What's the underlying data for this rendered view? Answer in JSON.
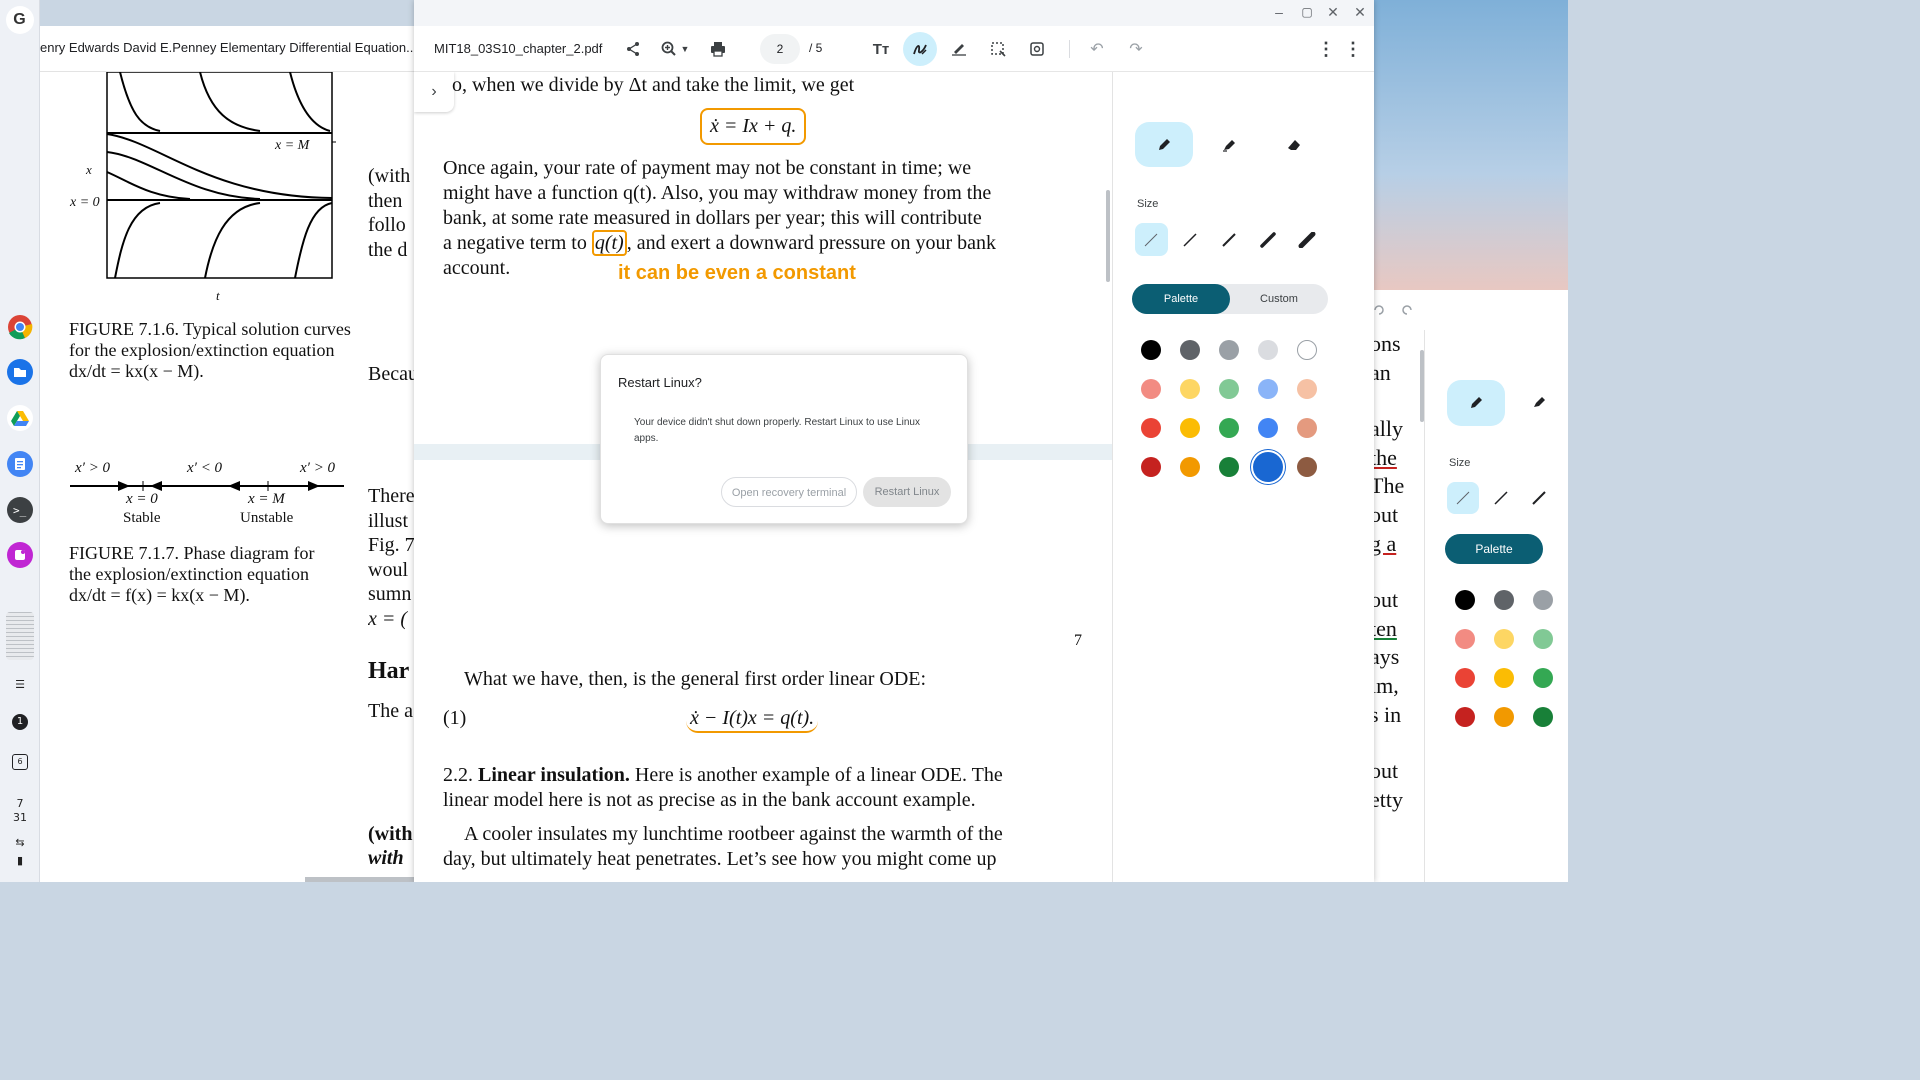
{
  "shelf": {
    "launcher": "G",
    "apps": [
      "chrome-icon",
      "files-icon",
      "drive-icon",
      "docs-icon",
      "terminal-icon",
      "screencast-icon"
    ],
    "status": {
      "notification": "1",
      "calendar_day": "6",
      "date_month": "7",
      "date_day": "31"
    }
  },
  "book": {
    "tab_title": "enry Edwards David E.Penney Elementary Differential Equation...",
    "fig716_caption": "FIGURE 7.1.6.   Typical solution curves for the explosion/extinction equation dx/dt = kx(x − M).",
    "fig716_xlabel": "t",
    "fig716_ylabel": "x",
    "fig716_xm": "x = M",
    "fig716_x0": "x = 0",
    "phase_labels": [
      "x′ > 0",
      "x′ < 0",
      "x′ > 0"
    ],
    "phase_points": [
      "x = 0",
      "x = M"
    ],
    "phase_stability": [
      "Stable",
      "Unstable"
    ],
    "fig717_caption": "FIGURE 7.1.7.   Phase diagram for the explosion/extinction equation dx/dt = f(x) = kx(x − M).",
    "col2_lines": [
      "(with",
      "then",
      "follo",
      "the d",
      "Becau",
      "There",
      "illust",
      "Fig. 7",
      "woul",
      "sumn",
      "x = (",
      "Har",
      "The a",
      "(with",
      "with "
    ]
  },
  "main": {
    "filename": "MIT18_03S10_chapter_2.pdf",
    "page_current": "2",
    "page_total": "/  5",
    "doc": {
      "line_top": "o, when we divide by Δt and take the limit, we get",
      "eq_top": "ẋ = Ix + q.",
      "para1_l1": "Once again, your rate of payment may not be constant in time; we",
      "para1_l2": "might have a function q(t). Also, you may withdraw money from the",
      "para1_l3": "bank, at some rate measured in dollars per year; this will contribute",
      "para1_l4a": "a negative term to",
      "para1_l4b": "q(t)",
      "para1_l4c": ", and exert a downward pressure on your bank",
      "para1_l5": "account.",
      "annotation": "it can be even a constant",
      "page_number": "7",
      "line_ode": "What we have, then, is the general first order linear ODE:",
      "eq_label": "(1)",
      "eq_ode": "ẋ − I(t)x = q(t).",
      "sec_num": "2.2.",
      "sec_title": "Linear insulation.",
      "sec_l1_rest": "Here is another example of a linear ODE. The",
      "sec_l2": "linear model here is not as precise as in the bank account example.",
      "p3_l1": "A cooler insulates my lunchtime rootbeer against the warmth of the",
      "p3_l2": "day, but ultimately heat penetrates. Let’s see how you might come up"
    },
    "panel": {
      "size_label": "Size",
      "palette_label": "Palette",
      "custom_label": "Custom"
    }
  },
  "dialog": {
    "title": "Restart Linux?",
    "message": "Your device didn't shut down properly. Restart Linux to use Linux apps.",
    "secondary": "Open recovery terminal",
    "primary": "Restart Linux"
  },
  "bgwin": {
    "size_label": "Size",
    "palette_label": "Palette",
    "text_fragments": [
      "ons",
      "an",
      "ally",
      "the",
      "The",
      "out",
      "g a",
      "out",
      "ten",
      "ays",
      "ım,",
      "s in",
      "out",
      "etty"
    ]
  },
  "colors": {
    "accent": "#0b5e73",
    "highlight": "#cdeffc",
    "annotation": "#f29900",
    "palette": [
      "#000000",
      "#5f6368",
      "#9aa0a6",
      "#dadce0",
      "#ffffff",
      "#f28b82",
      "#fdd663",
      "#81c995",
      "#8ab4f8",
      "#f6c1a4",
      "#ea4335",
      "#fbbc04",
      "#34a853",
      "#4285f4",
      "#e49a7f",
      "#c5221f",
      "#f29900",
      "#188038",
      "#1967d2",
      "#8d5b41"
    ]
  }
}
